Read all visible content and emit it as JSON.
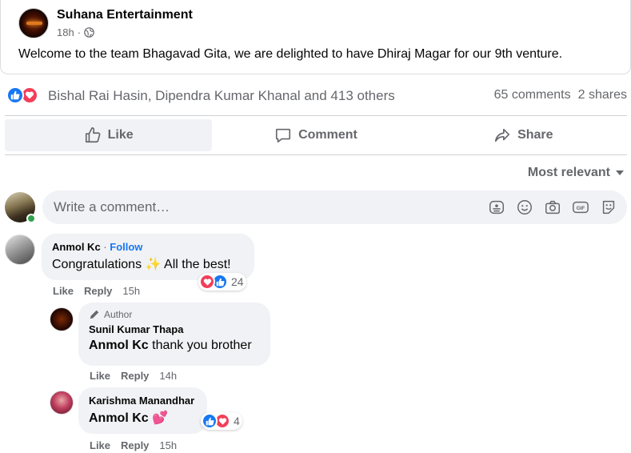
{
  "post": {
    "page_name": "Suhana Entertainment",
    "time": "18h",
    "privacy_icon": "globe-icon",
    "text": "Welcome to the team Bhagavad Gita, we are delighted to have Dhiraj Magar for our 9th venture."
  },
  "reactions": {
    "types": [
      "like",
      "love"
    ],
    "reactors": "Bishal Rai Hasin, Dipendra Kumar Khanal and 413 others",
    "comments": "65 comments",
    "shares": "2 shares"
  },
  "actions": {
    "like": "Like",
    "comment": "Comment",
    "share": "Share"
  },
  "sort": {
    "label": "Most relevant"
  },
  "composer": {
    "placeholder": "Write a comment…"
  },
  "comments": [
    {
      "name": "Anmol Kc",
      "follow": "Follow",
      "text_before": "Congratulations",
      "emoji": "✨",
      "text_after": "All the best!",
      "like": "Like",
      "reply": "Reply",
      "time": "15h",
      "reaction_count": "24"
    },
    {
      "author_label": "Author",
      "name": "Sunil Kumar Thapa",
      "mention": "Anmol Kc",
      "text": "thank you brother",
      "like": "Like",
      "reply": "Reply",
      "time": "14h"
    },
    {
      "name": "Karishma Manandhar",
      "mention": "Anmol Kc",
      "emoji": "💕",
      "like": "Like",
      "reply": "Reply",
      "time": "15h",
      "reaction_count": "4"
    }
  ],
  "colors": {
    "accent": "#1877f2",
    "love": "#f33e58",
    "secondary_text": "#65676b",
    "bubble": "#f0f2f5"
  }
}
